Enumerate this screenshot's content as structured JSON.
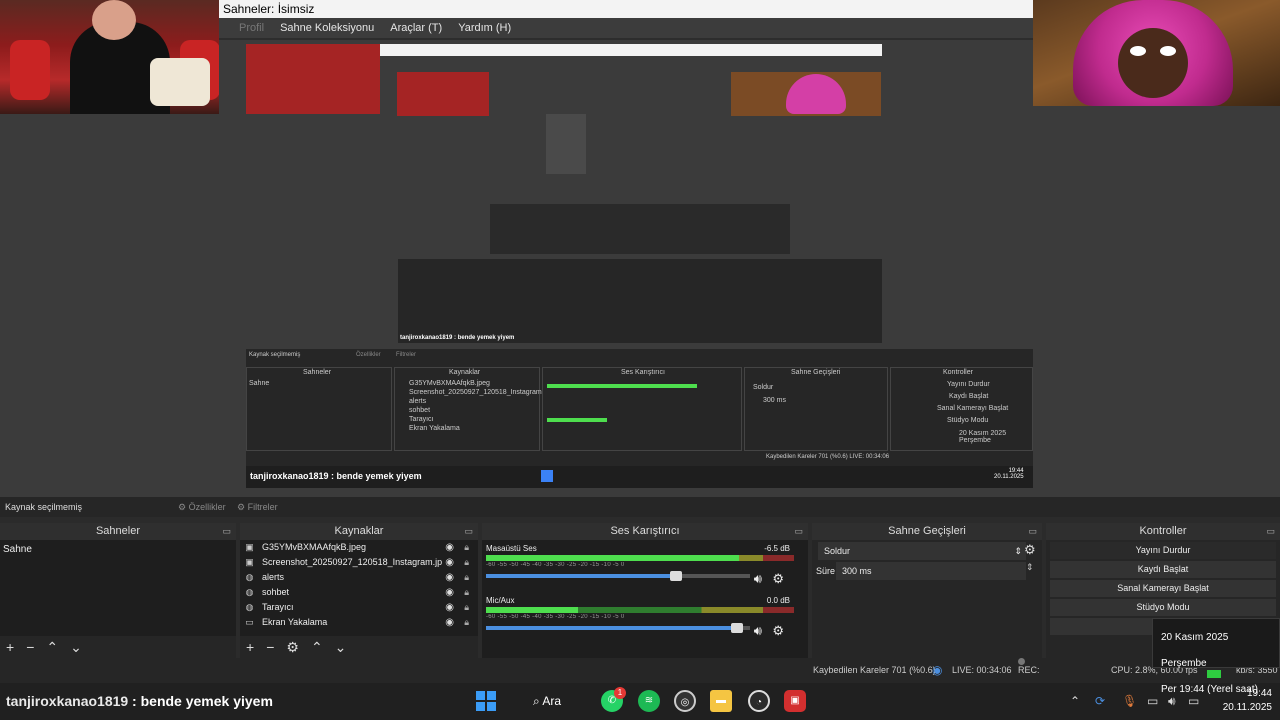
{
  "window": {
    "title": "Sahneler: İsimsiz",
    "menu": [
      "Profil",
      "Sahne Koleksiyonu",
      "Araçlar (T)",
      "Yardım (H)"
    ],
    "nested_title": "Sahneler: İsimsiz"
  },
  "toolbar": {
    "no_source": "Kaynak seçilmemiş",
    "properties": "Özellikler",
    "filters": "Filtreler"
  },
  "scenes": {
    "header": "Sahneler",
    "items": [
      "Sahne"
    ]
  },
  "sources": {
    "header": "Kaynaklar",
    "items": [
      {
        "name": "G35YMvBXMAAfqkB.jpeg",
        "icon": "image-icon"
      },
      {
        "name": "Screenshot_20250927_120518_Instagram.jp",
        "icon": "image-icon"
      },
      {
        "name": "alerts",
        "icon": "globe-icon"
      },
      {
        "name": "sohbet",
        "icon": "globe-icon"
      },
      {
        "name": "Tarayıcı",
        "icon": "globe-icon"
      },
      {
        "name": "Ekran Yakalama",
        "icon": "monitor-icon"
      }
    ]
  },
  "mixer": {
    "header": "Ses Karıştırıcı",
    "channels": [
      {
        "name": "Masaüstü Ses",
        "db": "-6.5 dB",
        "level": 0.82,
        "volume": 0.72
      },
      {
        "name": "Mic/Aux",
        "db": "0.0 dB",
        "level": 0.3,
        "volume": 0.95
      }
    ],
    "scale": "-60  -55  -50  -45  -40  -35  -30  -25  -20  -15  -10  -5  0"
  },
  "transitions": {
    "header": "Sahne Geçişleri",
    "selected": "Soldur",
    "duration_label": "Süre",
    "duration_value": "300 ms"
  },
  "controls": {
    "header": "Kontroller",
    "buttons": [
      "Yayını Durdur",
      "Kaydı Başlat",
      "Sanal Kamerayı Başlat",
      "Stüdyo Modu"
    ]
  },
  "status": {
    "dropped": "Kaybedilen Kareler 701 (%0.6)",
    "live": "LIVE: 00:34:06",
    "rec": "REC: 00:00:00",
    "cpu": "CPU: 2.8%, 60.00 fps",
    "kbps": "kb/s: 3550"
  },
  "taskbar": {
    "chat_user": "tanjiroxkanao1819",
    "chat_text": " : bende yemek yiyem",
    "search": "Ara",
    "time": "19:44",
    "date": "20.11.2025",
    "badge": "1"
  },
  "tooltip": {
    "line1": "20 Kasım 2025 Perşembe",
    "line2": "Per 19:44 (Yerel saat)"
  },
  "colors": {
    "accent_blue": "#4b8fe0",
    "meter_green": "#4ede4e",
    "live_green": "#2ecc40"
  }
}
